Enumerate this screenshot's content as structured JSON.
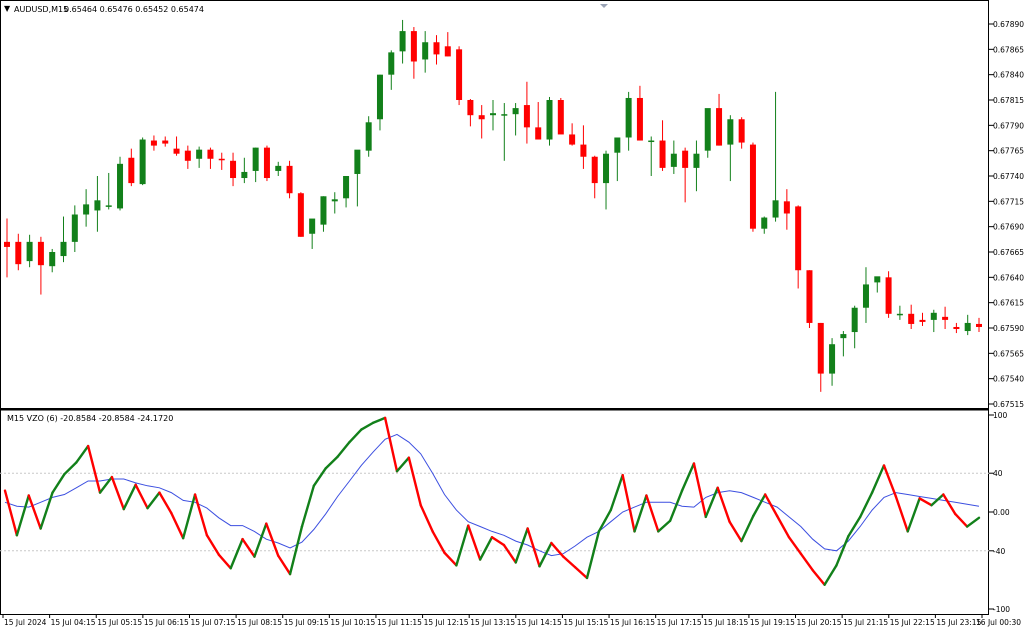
{
  "header": {
    "arrow": "▼",
    "symbol_period": "AUDUSD,M15",
    "ohlc": "0.65464 0.65476 0.65452 0.65474"
  },
  "indicator_header": "M15 VZO (6) -20.8584 -20.8584 -24.1720",
  "colors": {
    "bull": "#12801a",
    "bear": "#ff0000",
    "signal": "#3c4fe0",
    "grid": "#c8c8c8",
    "axis": "#000000"
  },
  "chart_data": [
    {
      "type": "candlestick",
      "symbol": "AUDUSD",
      "timeframe": "M15",
      "ylim": [
        0.67505,
        0.67905
      ],
      "y_ticks": [
        "0.67890",
        "0.67865",
        "0.67840",
        "0.67815",
        "0.67790",
        "0.67765",
        "0.67740",
        "0.67715",
        "0.67690",
        "0.67665",
        "0.67640",
        "0.67615",
        "0.67590",
        "0.67565",
        "0.67540",
        "0.67515"
      ],
      "x_ticks": [
        "15 Jul 2024",
        "15 Jul 04:15",
        "15 Jul 05:15",
        "15 Jul 06:15",
        "15 Jul 07:15",
        "15 Jul 08:15",
        "15 Jul 09:15",
        "15 Jul 10:15",
        "15 Jul 11:15",
        "15 Jul 12:15",
        "15 Jul 13:15",
        "15 Jul 14:15",
        "15 Jul 15:15",
        "15 Jul 16:15",
        "15 Jul 17:15",
        "15 Jul 18:15",
        "15 Jul 19:15",
        "15 Jul 20:15",
        "15 Jul 21:15",
        "15 Jul 22:15",
        "15 Jul 23:15",
        "16 Jul 00:30"
      ],
      "candles": [
        {
          "o": 0.67675,
          "h": 0.67698,
          "l": 0.6764,
          "c": 0.6767
        },
        {
          "o": 0.67675,
          "h": 0.67683,
          "l": 0.67647,
          "c": 0.67653
        },
        {
          "o": 0.67656,
          "h": 0.67682,
          "l": 0.6765,
          "c": 0.67675
        },
        {
          "o": 0.67675,
          "h": 0.6768,
          "l": 0.67623,
          "c": 0.67652
        },
        {
          "o": 0.67651,
          "h": 0.67668,
          "l": 0.67645,
          "c": 0.67665
        },
        {
          "o": 0.67661,
          "h": 0.677,
          "l": 0.67655,
          "c": 0.67675
        },
        {
          "o": 0.67675,
          "h": 0.67711,
          "l": 0.67665,
          "c": 0.67702
        },
        {
          "o": 0.67702,
          "h": 0.67727,
          "l": 0.6769,
          "c": 0.67712
        },
        {
          "o": 0.67706,
          "h": 0.6774,
          "l": 0.67685,
          "c": 0.67716
        },
        {
          "o": 0.6771,
          "h": 0.67743,
          "l": 0.67707,
          "c": 0.67711
        },
        {
          "o": 0.67708,
          "h": 0.67759,
          "l": 0.67706,
          "c": 0.67752
        },
        {
          "o": 0.67758,
          "h": 0.67767,
          "l": 0.6773,
          "c": 0.67733
        },
        {
          "o": 0.67732,
          "h": 0.67778,
          "l": 0.67731,
          "c": 0.67776
        },
        {
          "o": 0.67775,
          "h": 0.6778,
          "l": 0.67765,
          "c": 0.6777
        },
        {
          "o": 0.67775,
          "h": 0.67779,
          "l": 0.67769,
          "c": 0.67772
        },
        {
          "o": 0.67767,
          "h": 0.67779,
          "l": 0.6776,
          "c": 0.67762
        },
        {
          "o": 0.67765,
          "h": 0.6777,
          "l": 0.67747,
          "c": 0.67755
        },
        {
          "o": 0.67757,
          "h": 0.67769,
          "l": 0.67748,
          "c": 0.67766
        },
        {
          "o": 0.67766,
          "h": 0.67768,
          "l": 0.67747,
          "c": 0.67757
        },
        {
          "o": 0.67757,
          "h": 0.67763,
          "l": 0.67746,
          "c": 0.67756
        },
        {
          "o": 0.67755,
          "h": 0.67763,
          "l": 0.6773,
          "c": 0.67738
        },
        {
          "o": 0.67738,
          "h": 0.67758,
          "l": 0.67733,
          "c": 0.67744
        },
        {
          "o": 0.67745,
          "h": 0.67768,
          "l": 0.67734,
          "c": 0.67768
        },
        {
          "o": 0.67768,
          "h": 0.6777,
          "l": 0.67735,
          "c": 0.67738
        },
        {
          "o": 0.67745,
          "h": 0.67754,
          "l": 0.6774,
          "c": 0.6775
        },
        {
          "o": 0.6775,
          "h": 0.67755,
          "l": 0.67718,
          "c": 0.67723
        },
        {
          "o": 0.67723,
          "h": 0.67724,
          "l": 0.6768,
          "c": 0.6768
        },
        {
          "o": 0.67683,
          "h": 0.67697,
          "l": 0.67668,
          "c": 0.67698
        },
        {
          "o": 0.67692,
          "h": 0.6772,
          "l": 0.67685,
          "c": 0.6772
        },
        {
          "o": 0.67715,
          "h": 0.67724,
          "l": 0.67703,
          "c": 0.67717
        },
        {
          "o": 0.67718,
          "h": 0.6774,
          "l": 0.67709,
          "c": 0.6774
        },
        {
          "o": 0.67742,
          "h": 0.6776,
          "l": 0.6771,
          "c": 0.67766
        },
        {
          "o": 0.67765,
          "h": 0.67799,
          "l": 0.67759,
          "c": 0.67793
        },
        {
          "o": 0.67796,
          "h": 0.6784,
          "l": 0.67785,
          "c": 0.6784
        },
        {
          "o": 0.6784,
          "h": 0.67864,
          "l": 0.67825,
          "c": 0.67862
        },
        {
          "o": 0.67863,
          "h": 0.67894,
          "l": 0.67851,
          "c": 0.67883
        },
        {
          "o": 0.67883,
          "h": 0.67887,
          "l": 0.67836,
          "c": 0.67853
        },
        {
          "o": 0.67855,
          "h": 0.67883,
          "l": 0.67842,
          "c": 0.67872
        },
        {
          "o": 0.67872,
          "h": 0.67879,
          "l": 0.6785,
          "c": 0.6786
        },
        {
          "o": 0.67868,
          "h": 0.67882,
          "l": 0.67858,
          "c": 0.67858
        },
        {
          "o": 0.67865,
          "h": 0.67868,
          "l": 0.6781,
          "c": 0.67815
        },
        {
          "o": 0.67815,
          "h": 0.67816,
          "l": 0.67789,
          "c": 0.678
        },
        {
          "o": 0.678,
          "h": 0.6781,
          "l": 0.67777,
          "c": 0.67796
        },
        {
          "o": 0.678,
          "h": 0.67815,
          "l": 0.67785,
          "c": 0.67802
        },
        {
          "o": 0.678,
          "h": 0.67812,
          "l": 0.67755,
          "c": 0.67801
        },
        {
          "o": 0.67801,
          "h": 0.67812,
          "l": 0.6778,
          "c": 0.67807
        },
        {
          "o": 0.6781,
          "h": 0.67833,
          "l": 0.67772,
          "c": 0.67788
        },
        {
          "o": 0.67788,
          "h": 0.67813,
          "l": 0.67778,
          "c": 0.67776
        },
        {
          "o": 0.67776,
          "h": 0.67818,
          "l": 0.6777,
          "c": 0.67815
        },
        {
          "o": 0.67815,
          "h": 0.67817,
          "l": 0.67782,
          "c": 0.67781
        },
        {
          "o": 0.67781,
          "h": 0.67792,
          "l": 0.6777,
          "c": 0.67771
        },
        {
          "o": 0.67771,
          "h": 0.6779,
          "l": 0.67747,
          "c": 0.67759
        },
        {
          "o": 0.67759,
          "h": 0.6776,
          "l": 0.67718,
          "c": 0.67733
        },
        {
          "o": 0.67733,
          "h": 0.67765,
          "l": 0.67707,
          "c": 0.67762
        },
        {
          "o": 0.67763,
          "h": 0.6777,
          "l": 0.67735,
          "c": 0.67778
        },
        {
          "o": 0.67778,
          "h": 0.67823,
          "l": 0.67765,
          "c": 0.67817
        },
        {
          "o": 0.67817,
          "h": 0.67829,
          "l": 0.67775,
          "c": 0.67775
        },
        {
          "o": 0.67775,
          "h": 0.67779,
          "l": 0.6774,
          "c": 0.67775
        },
        {
          "o": 0.67775,
          "h": 0.67795,
          "l": 0.67745,
          "c": 0.67748
        },
        {
          "o": 0.67749,
          "h": 0.67775,
          "l": 0.67742,
          "c": 0.67762
        },
        {
          "o": 0.67765,
          "h": 0.67768,
          "l": 0.67714,
          "c": 0.67748
        },
        {
          "o": 0.67748,
          "h": 0.67775,
          "l": 0.67725,
          "c": 0.67762
        },
        {
          "o": 0.67765,
          "h": 0.67806,
          "l": 0.67758,
          "c": 0.67807
        },
        {
          "o": 0.67807,
          "h": 0.67821,
          "l": 0.6777,
          "c": 0.6777
        },
        {
          "o": 0.67771,
          "h": 0.678,
          "l": 0.67735,
          "c": 0.67796
        },
        {
          "o": 0.67796,
          "h": 0.67798,
          "l": 0.67767,
          "c": 0.67773
        },
        {
          "o": 0.67771,
          "h": 0.67773,
          "l": 0.67685,
          "c": 0.67688
        },
        {
          "o": 0.67688,
          "h": 0.677,
          "l": 0.67683,
          "c": 0.67699
        },
        {
          "o": 0.67699,
          "h": 0.67823,
          "l": 0.67695,
          "c": 0.67716
        },
        {
          "o": 0.67715,
          "h": 0.67727,
          "l": 0.67687,
          "c": 0.67703
        },
        {
          "o": 0.6771,
          "h": 0.67711,
          "l": 0.67629,
          "c": 0.67647
        },
        {
          "o": 0.67647,
          "h": 0.67647,
          "l": 0.6759,
          "c": 0.67595
        },
        {
          "o": 0.67595,
          "h": 0.67595,
          "l": 0.67527,
          "c": 0.67545
        },
        {
          "o": 0.67545,
          "h": 0.6758,
          "l": 0.67533,
          "c": 0.67574
        },
        {
          "o": 0.6758,
          "h": 0.67587,
          "l": 0.67562,
          "c": 0.67584
        },
        {
          "o": 0.67586,
          "h": 0.67612,
          "l": 0.6757,
          "c": 0.6761
        },
        {
          "o": 0.6761,
          "h": 0.6765,
          "l": 0.67595,
          "c": 0.67633
        },
        {
          "o": 0.67635,
          "h": 0.6764,
          "l": 0.67625,
          "c": 0.67641
        },
        {
          "o": 0.6764,
          "h": 0.67646,
          "l": 0.676,
          "c": 0.67604
        },
        {
          "o": 0.67604,
          "h": 0.67612,
          "l": 0.67598,
          "c": 0.67604
        },
        {
          "o": 0.67604,
          "h": 0.67613,
          "l": 0.67589,
          "c": 0.67594
        },
        {
          "o": 0.67598,
          "h": 0.67605,
          "l": 0.67592,
          "c": 0.67596
        },
        {
          "o": 0.67598,
          "h": 0.67608,
          "l": 0.67586,
          "c": 0.67605
        },
        {
          "o": 0.67601,
          "h": 0.67611,
          "l": 0.67589,
          "c": 0.67598
        },
        {
          "o": 0.67591,
          "h": 0.67595,
          "l": 0.67585,
          "c": 0.67589
        },
        {
          "o": 0.67587,
          "h": 0.67603,
          "l": 0.67583,
          "c": 0.67595
        },
        {
          "o": 0.67594,
          "h": 0.676,
          "l": 0.67586,
          "c": 0.67591
        }
      ]
    },
    {
      "type": "line",
      "name": "VZO (6)",
      "ylim": [
        -100,
        100
      ],
      "y_ticks": [
        "100",
        "40",
        "0.00",
        "-40",
        "-100"
      ],
      "vzo": [
        22,
        -24,
        17,
        -17,
        20,
        39,
        51,
        68,
        20,
        36,
        3,
        28,
        4,
        20,
        -1,
        -27,
        18,
        -24,
        -44,
        -58,
        -28,
        -46,
        -12,
        -45,
        -64,
        -15,
        27,
        45,
        57,
        72,
        85,
        92,
        97,
        42,
        56,
        7,
        -20,
        -42,
        -55,
        -14,
        -49,
        -26,
        -34,
        -52,
        -17,
        -56,
        -32,
        -46,
        -57,
        -68,
        -20,
        2,
        38,
        -20,
        17,
        -20,
        -9,
        22,
        50,
        -5,
        25,
        -10,
        -30,
        -4,
        18,
        -4,
        -26,
        -43,
        -60,
        -75,
        -55,
        -25,
        -5,
        20,
        48,
        16,
        -20,
        14,
        7,
        18,
        -2,
        -15,
        -6
      ],
      "signal": [
        10,
        6,
        5,
        10,
        15,
        18,
        25,
        32,
        32,
        34,
        34,
        30,
        27,
        25,
        20,
        12,
        10,
        4,
        -6,
        -14,
        -14,
        -20,
        -28,
        -32,
        -37,
        -31,
        -18,
        -2,
        16,
        32,
        48,
        62,
        75,
        80,
        72,
        60,
        40,
        18,
        2,
        -10,
        -15,
        -20,
        -24,
        -30,
        -34,
        -40,
        -45,
        -43,
        -35,
        -26,
        -20,
        -10,
        0,
        5,
        10,
        10,
        10,
        6,
        5,
        15,
        20,
        22,
        20,
        15,
        10,
        5,
        -5,
        -15,
        -28,
        -38,
        -40,
        -30,
        -15,
        2,
        15,
        20,
        18,
        16,
        14,
        12,
        10,
        8,
        6
      ]
    }
  ]
}
